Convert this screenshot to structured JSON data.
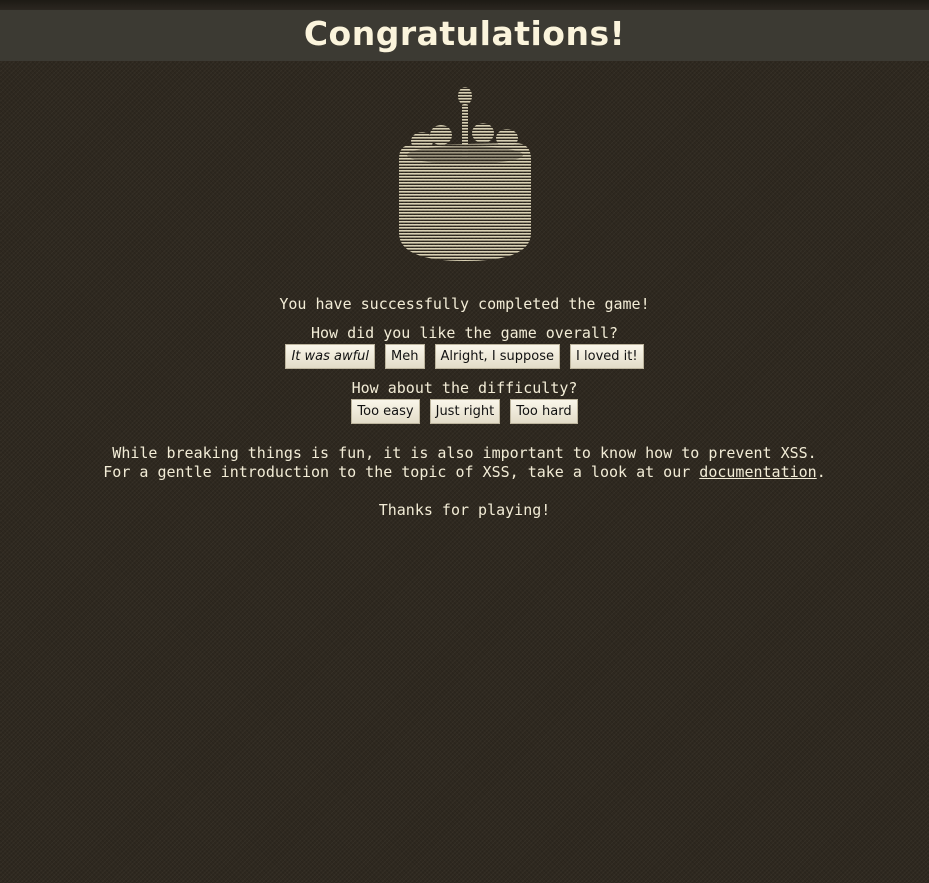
{
  "header": {
    "title": "Congratulations!"
  },
  "message": {
    "completed": "You have successfully completed the game!"
  },
  "feedback": {
    "overall_question": "How did you like the game overall?",
    "overall_options": [
      "It was awful",
      "Meh",
      "Alright, I suppose",
      "I loved it!"
    ],
    "difficulty_question": "How about the difficulty?",
    "difficulty_options": [
      "Too easy",
      "Just right",
      "Too hard"
    ]
  },
  "info": {
    "line1": "While breaking things is fun, it is also important to know how to prevent XSS.",
    "line2_prefix": "For a gentle introduction to the topic of XSS, take a look at our ",
    "link_text": "documentation",
    "line2_suffix": "."
  },
  "closing": {
    "thanks": "Thanks for playing!"
  },
  "colors": {
    "background": "#2e281f",
    "header_bar": "#3c3a33",
    "text": "#f2ecd6",
    "button_face": "#efe9d7"
  },
  "image": {
    "icon": "cake-icon"
  }
}
